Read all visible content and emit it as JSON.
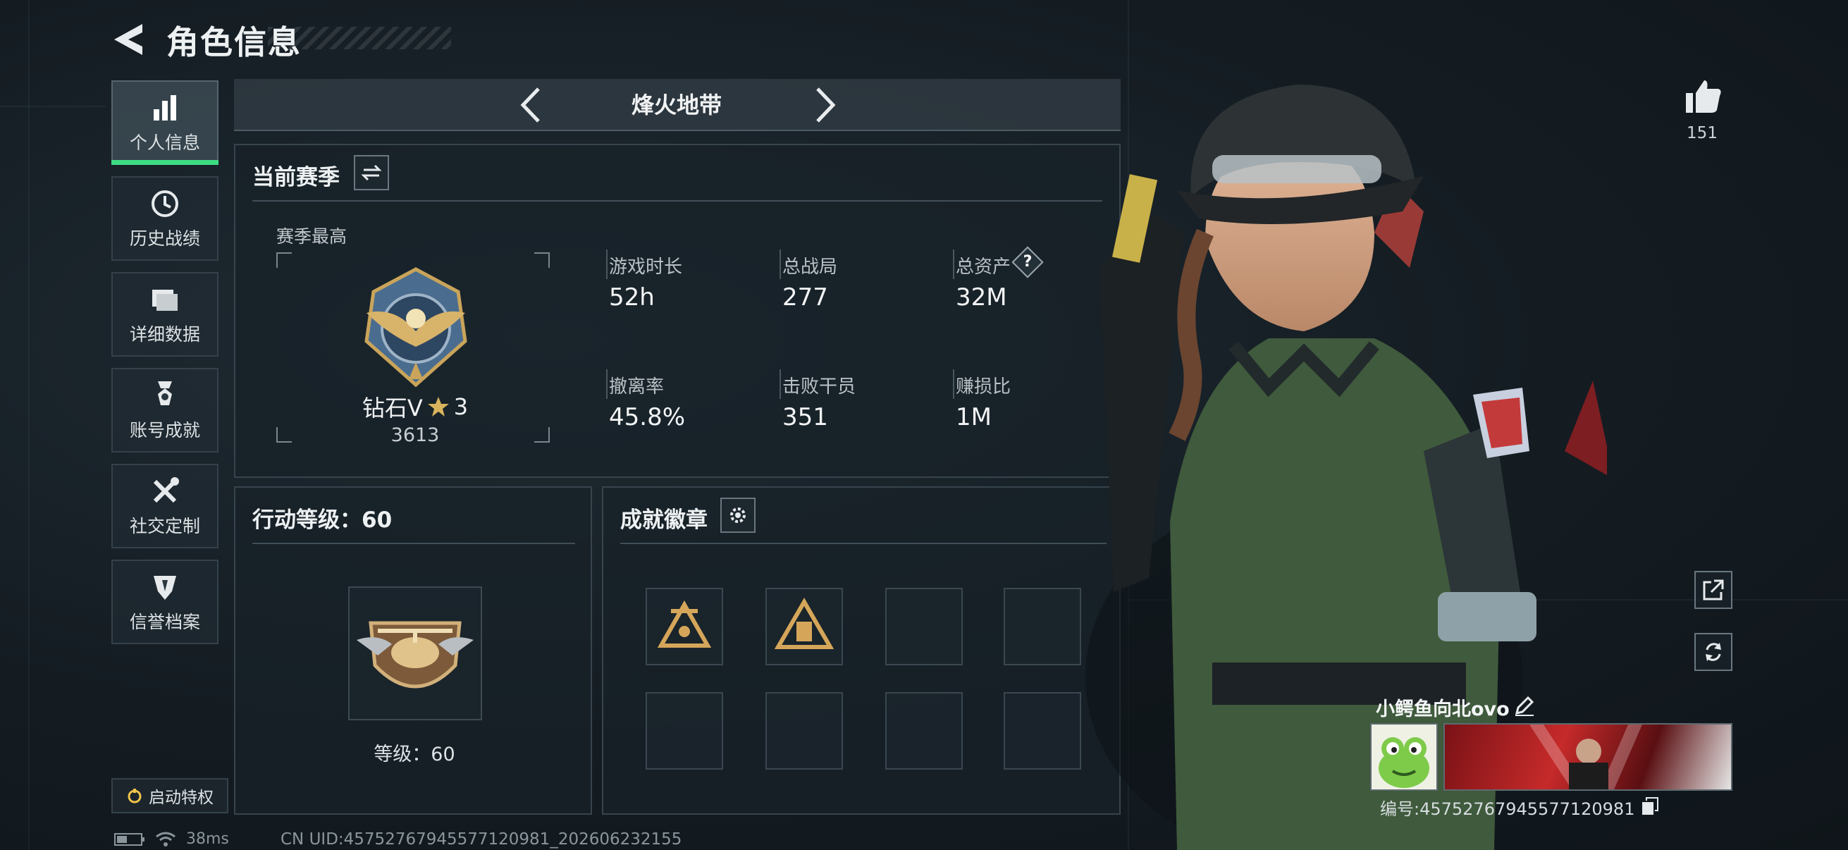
{
  "header": {
    "title": "角色信息"
  },
  "sidebar": {
    "items": [
      {
        "label": "个人信息",
        "icon": "bar-chart-icon",
        "active": true
      },
      {
        "label": "历史战绩",
        "icon": "history-clock-icon",
        "active": false
      },
      {
        "label": "详细数据",
        "icon": "folder-data-icon",
        "active": false
      },
      {
        "label": "账号成就",
        "icon": "achievement-medal-icon",
        "active": false
      },
      {
        "label": "社交定制",
        "icon": "wrench-tools-icon",
        "active": false
      },
      {
        "label": "信誉档案",
        "icon": "reputation-shield-icon",
        "active": false
      }
    ],
    "perk_button": "启动特权"
  },
  "mode": {
    "title": "烽火地带"
  },
  "season": {
    "title": "当前赛季",
    "best_label": "赛季最高",
    "rank_name": "钻石V",
    "rank_stars": "3",
    "rank_points": "3613",
    "stats": [
      {
        "label": "游戏时长",
        "value": "52h"
      },
      {
        "label": "总战局",
        "value": "277"
      },
      {
        "label": "总资产",
        "value": "32M",
        "help": "?"
      },
      {
        "label": "撤离率",
        "value": "45.8%"
      },
      {
        "label": "击败干员",
        "value": "351"
      },
      {
        "label": "赚损比",
        "value": "1M"
      }
    ]
  },
  "action_level": {
    "title": "行动等级：60",
    "level_text": "等级：60"
  },
  "achievements": {
    "title": "成就徽章",
    "slots_filled": 2,
    "slots_total": 8
  },
  "profile": {
    "likes": "151",
    "name": "小鳄鱼向北ovo",
    "id_text": "编号:45752767945577120981"
  },
  "status": {
    "ping": "38ms",
    "uid": "CN UID:45752767945577120981_202606232155"
  },
  "colors": {
    "accent": "#3ddc84",
    "background": "#141c22",
    "panel_border": "#37444d",
    "gold": "#c9a45a"
  }
}
